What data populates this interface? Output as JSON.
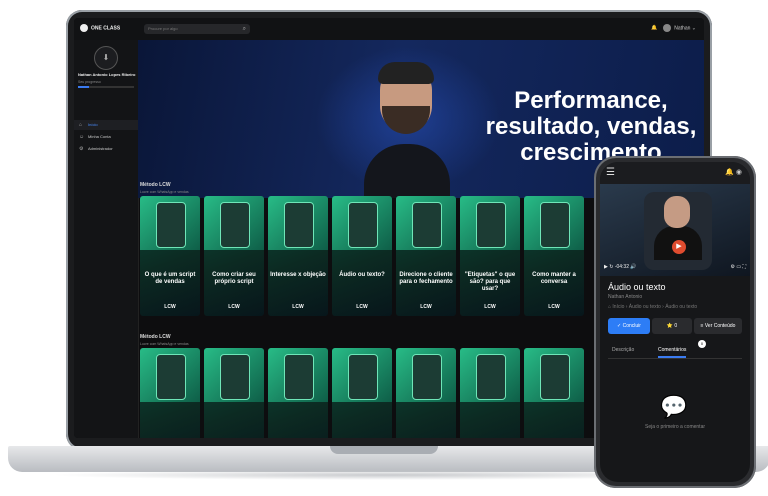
{
  "app": {
    "brand": "ONE CLASS",
    "search_placeholder": "Procure por algo"
  },
  "topbar": {
    "user": "Nathan",
    "chevron": "⌄",
    "bell_icon": "bell-icon"
  },
  "sidebar": {
    "profile_name": "Nathan Antonio Lopes Ribeiro",
    "profile_sub": "Seu progresso",
    "progress": 0.2,
    "items": [
      {
        "label": "Início",
        "icon": "home-icon",
        "glyph": "⌂",
        "active": true
      },
      {
        "label": "Minha Conta",
        "icon": "user-icon",
        "glyph": "☺",
        "active": false
      },
      {
        "label": "Administrador",
        "icon": "gear-icon",
        "glyph": "⚙",
        "active": false
      }
    ]
  },
  "hero": {
    "headline_1": "Performance,",
    "headline_2": "resultado, vendas,",
    "headline_3": "crescimento"
  },
  "sections": [
    {
      "title": "Método LCW",
      "subtitle": "Lucre com WhatsApp e vendas",
      "cards": [
        {
          "text": "O que é um script de vendas",
          "logo": "LCW"
        },
        {
          "text": "Como criar seu próprio script",
          "logo": "LCW"
        },
        {
          "text": "Interesse x objeção",
          "logo": "LCW"
        },
        {
          "text": "Áudio ou texto?",
          "logo": "LCW"
        },
        {
          "text": "Direcione o cliente para o fechamento",
          "logo": "LCW"
        },
        {
          "text": "\"Etiquetas\" o que são? para que usar?",
          "logo": "LCW"
        },
        {
          "text": "Como manter a conversa",
          "logo": "LCW"
        }
      ]
    },
    {
      "title": "Método LCW",
      "subtitle": "Lucre com WhatsApp e vendas",
      "cards": [
        {
          "text": "",
          "logo": ""
        },
        {
          "text": "",
          "logo": ""
        },
        {
          "text": "",
          "logo": ""
        },
        {
          "text": "",
          "logo": ""
        },
        {
          "text": "",
          "logo": ""
        },
        {
          "text": "",
          "logo": ""
        },
        {
          "text": "",
          "logo": ""
        }
      ]
    }
  ],
  "phone": {
    "menu_glyph": "☰",
    "status_icons": "🔔 ◉",
    "video_time": "-04:32",
    "play_glyph": "▶",
    "controls_left": "▶  ↻  -04:32  🔊",
    "controls_right": "⚙ ▭ ⛶",
    "title": "Áudio ou texto",
    "author": "Nathan Antonio",
    "breadcrumb": "⌂  Início  ›  Áudio ou texto  ›  Áudio ou texto",
    "btn_concluir": "✓ Concluir",
    "btn_like": "⭐ 0",
    "btn_ver": "≡ Ver Conteúdo",
    "tab_desc": "Descrição",
    "tab_comments": "Comentários",
    "comment_badge": "0",
    "empty_text": "Seja o primeiro a comentar",
    "comment_glyph": "💬",
    "progress": 0.24
  }
}
